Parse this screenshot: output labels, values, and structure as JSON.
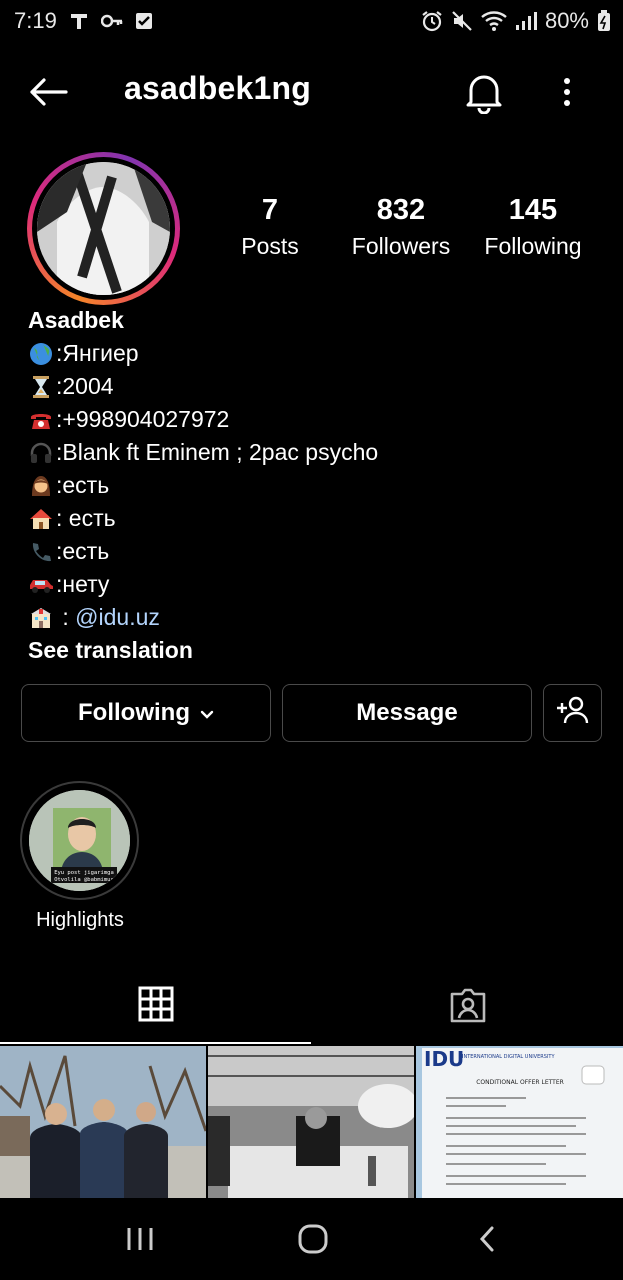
{
  "status_bar": {
    "time": "7:19",
    "battery": "80%",
    "icons": [
      "tiktok-icon",
      "key-icon",
      "checkbox-icon",
      "alarm-icon",
      "mute-icon",
      "wifi-icon",
      "signal-icon",
      "battery-icon"
    ]
  },
  "header": {
    "username": "asadbek1ng",
    "icons": [
      "back-arrow-icon",
      "bell-icon",
      "more-vertical-icon"
    ]
  },
  "profile": {
    "stats": [
      {
        "value": "7",
        "label": "Posts"
      },
      {
        "value": "832",
        "label": "Followers"
      },
      {
        "value": "145",
        "label": "Following"
      }
    ],
    "name": "Asadbek",
    "bio_lines": [
      {
        "icon": "globe-icon",
        "text": ":Янгиер"
      },
      {
        "icon": "hourglass-icon",
        "text": ":2004"
      },
      {
        "icon": "telephone-icon",
        "text": ":+998904027972"
      },
      {
        "icon": "headphones-icon",
        "text": ":Blank ft Eminem ; 2pac psycho"
      },
      {
        "icon": "girl-icon",
        "text": ":есть"
      },
      {
        "icon": "house-icon",
        "text": ": есть"
      },
      {
        "icon": "phone-receiver-icon",
        "text": " :есть"
      },
      {
        "icon": "car-icon",
        "text": " :нету"
      },
      {
        "icon": "school-icon",
        "text": " : ",
        "link": "@idu.uz"
      }
    ],
    "see_translation": "See translation"
  },
  "actions": {
    "following_label": "Following",
    "message_label": "Message"
  },
  "highlights": [
    {
      "label": "Highlights",
      "caption_line1": "Eyu post jigarimga",
      "caption_line2": "Otvolila @babmimus"
    }
  ],
  "tabs": [
    "grid-icon",
    "tagged-icon"
  ],
  "post_overlay_text": {
    "logo": "IDU",
    "university": "INTERNATIONAL DIGITAL UNIVERSITY",
    "letter_title": "CONDITIONAL OFFER LETTER"
  },
  "colors": {
    "background": "#000000",
    "link": "#b3d4fc",
    "button_border": "#4a4a4a"
  }
}
